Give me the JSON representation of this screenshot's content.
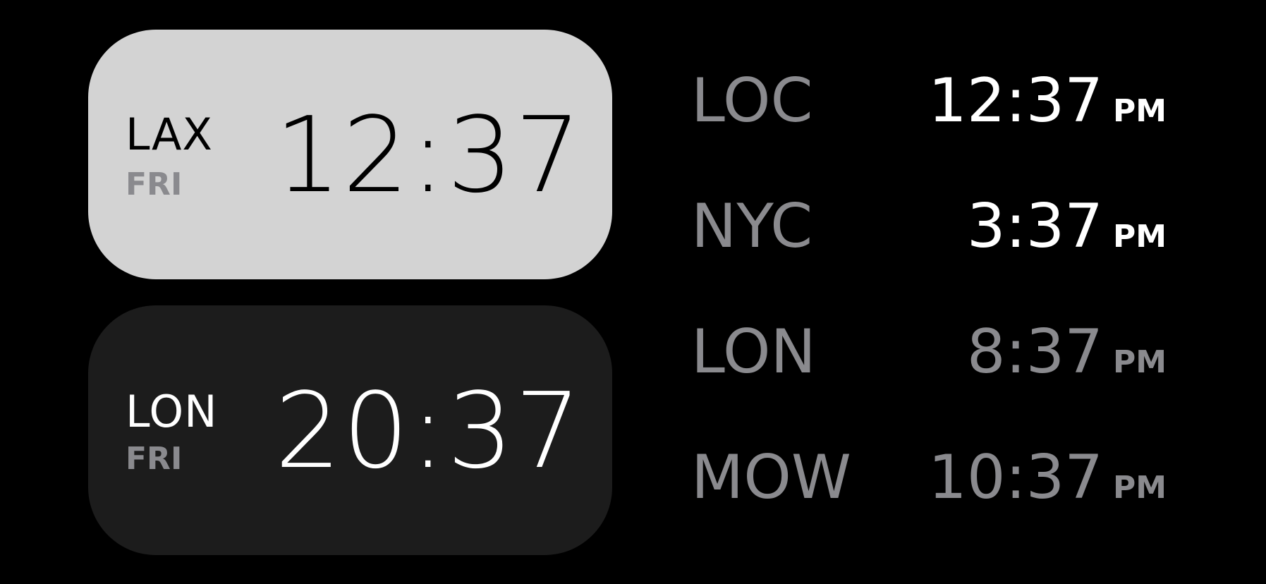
{
  "widgets": [
    {
      "city": "LAX",
      "day": "FRI",
      "time": "12:37",
      "theme": "light"
    },
    {
      "city": "LON",
      "day": "FRI",
      "time": "20:37",
      "theme": "dark"
    }
  ],
  "world_clock": [
    {
      "city": "LOC",
      "time": "12:37",
      "period": "PM",
      "emphasis": "bright"
    },
    {
      "city": "NYC",
      "time": "3:37",
      "period": "PM",
      "emphasis": "bright"
    },
    {
      "city": "LON",
      "time": "8:37",
      "period": "PM",
      "emphasis": "dim"
    },
    {
      "city": "MOW",
      "time": "10:37",
      "period": "PM",
      "emphasis": "dim"
    }
  ],
  "colors": {
    "background": "#000000",
    "light_widget": "#d3d3d3",
    "dark_widget": "#1c1c1c",
    "secondary_text": "#8a8a8e"
  }
}
